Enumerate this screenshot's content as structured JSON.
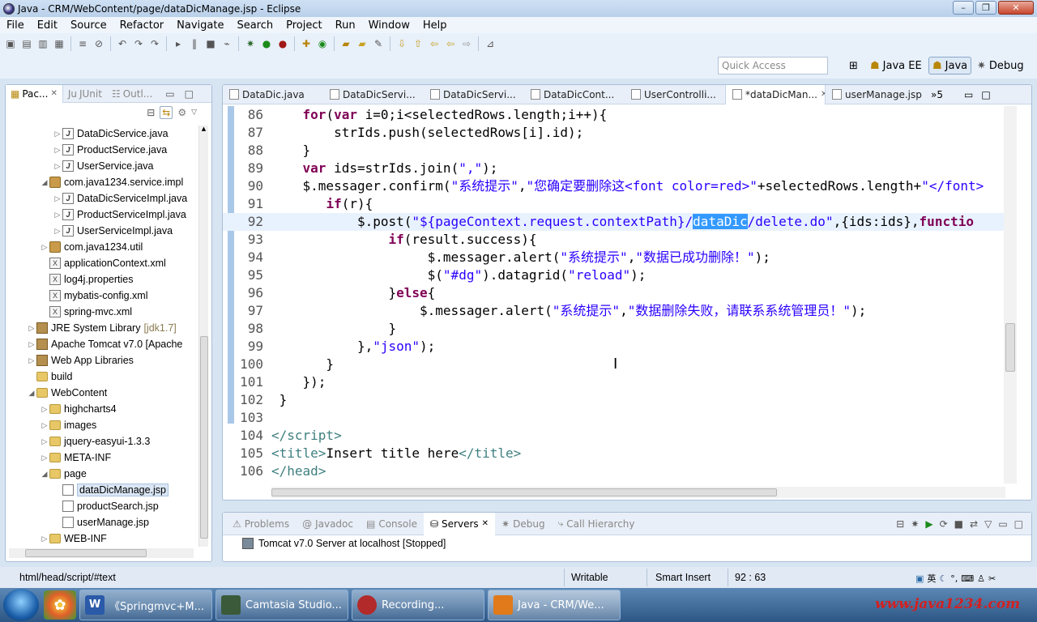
{
  "window": {
    "title": "Java - CRM/WebContent/page/dataDicManage.jsp - Eclipse"
  },
  "menu": [
    "File",
    "Edit",
    "Source",
    "Refactor",
    "Navigate",
    "Search",
    "Project",
    "Run",
    "Window",
    "Help"
  ],
  "quick_access": {
    "placeholder": "Quick Access"
  },
  "perspectives": [
    "Java EE",
    "Java",
    "Debug"
  ],
  "left_panel": {
    "tabs": [
      "Pac...",
      "JUnit",
      "Outl..."
    ],
    "tree": [
      {
        "label": "DataDicService.java",
        "type": "java",
        "indent": 4,
        "arrow": "▷"
      },
      {
        "label": "ProductService.java",
        "type": "java",
        "indent": 4,
        "arrow": "▷"
      },
      {
        "label": "UserService.java",
        "type": "java",
        "indent": 4,
        "arrow": "▷"
      },
      {
        "label": "com.java1234.service.impl",
        "type": "pack",
        "indent": 3,
        "arrow": "◢"
      },
      {
        "label": "DataDicServiceImpl.java",
        "type": "java",
        "indent": 4,
        "arrow": "▷"
      },
      {
        "label": "ProductServiceImpl.java",
        "type": "java",
        "indent": 4,
        "arrow": "▷"
      },
      {
        "label": "UserServiceImpl.java",
        "type": "java",
        "indent": 4,
        "arrow": "▷"
      },
      {
        "label": "com.java1234.util",
        "type": "pack",
        "indent": 3,
        "arrow": "▷"
      },
      {
        "label": "applicationContext.xml",
        "type": "xml",
        "indent": 3,
        "arrow": ""
      },
      {
        "label": "log4j.properties",
        "type": "xml",
        "indent": 3,
        "arrow": ""
      },
      {
        "label": "mybatis-config.xml",
        "type": "xml",
        "indent": 3,
        "arrow": ""
      },
      {
        "label": "spring-mvc.xml",
        "type": "xml",
        "indent": 3,
        "arrow": ""
      },
      {
        "label": "JRE System Library",
        "suffix": "[jdk1.7]",
        "type": "lib",
        "indent": 2,
        "arrow": "▷"
      },
      {
        "label": "Apache Tomcat v7.0 [Apache",
        "type": "lib",
        "indent": 2,
        "arrow": "▷"
      },
      {
        "label": "Web App Libraries",
        "type": "lib",
        "indent": 2,
        "arrow": "▷"
      },
      {
        "label": "build",
        "type": "folder",
        "indent": 2,
        "arrow": ""
      },
      {
        "label": "WebContent",
        "type": "folder",
        "indent": 2,
        "arrow": "◢"
      },
      {
        "label": "highcharts4",
        "type": "folder",
        "indent": 3,
        "arrow": "▷"
      },
      {
        "label": "images",
        "type": "folder",
        "indent": 3,
        "arrow": "▷"
      },
      {
        "label": "jquery-easyui-1.3.3",
        "type": "folder",
        "indent": 3,
        "arrow": "▷"
      },
      {
        "label": "META-INF",
        "type": "folder",
        "indent": 3,
        "arrow": "▷"
      },
      {
        "label": "page",
        "type": "folder",
        "indent": 3,
        "arrow": "◢"
      },
      {
        "label": "dataDicManage.jsp",
        "type": "jsp",
        "indent": 4,
        "arrow": "",
        "selected": true
      },
      {
        "label": "productSearch.jsp",
        "type": "jsp",
        "indent": 4,
        "arrow": ""
      },
      {
        "label": "userManage.jsp",
        "type": "jsp",
        "indent": 4,
        "arrow": ""
      },
      {
        "label": "WEB-INF",
        "type": "folder",
        "indent": 3,
        "arrow": "▷"
      }
    ]
  },
  "editor_tabs": [
    "DataDic.java",
    "DataDicServi...",
    "DataDicServi...",
    "DataDicCont...",
    "UserControlli...",
    "*dataDicMan...",
    "userManage.jsp"
  ],
  "editor_overflow": "»5",
  "code": [
    {
      "n": "86",
      "html": "    <span class='kw'>for</span>(<span class='kw'>var</span> i=0;i&lt;selectedRows.length;i++){"
    },
    {
      "n": "87",
      "html": "        strIds.push(selectedRows[i].id);"
    },
    {
      "n": "88",
      "html": "    }"
    },
    {
      "n": "89",
      "html": "    <span class='kw'>var</span> ids=strIds.join(<span class='str'>\",\"</span>);"
    },
    {
      "n": "90",
      "html": "    $.messager.confirm(<span class='str'>\"系统提示\"</span>,<span class='str'>\"您确定要删除这&lt;font color=red&gt;\"</span>+selectedRows.length+<span class='str'>\"&lt;/font&gt;</span>"
    },
    {
      "n": "91",
      "html": "       <span class='kw'>if</span>(r){"
    },
    {
      "n": "92",
      "html": "           $.post(<span class='str'>\"${pageContext.request.contextPath}/<span class='hl'>dataDic</span>/delete.do\"</span>,{ids:ids},<span class='kw'>functio</span>",
      "cur": true
    },
    {
      "n": "93",
      "html": "               <span class='kw'>if</span>(result.success){"
    },
    {
      "n": "94",
      "html": "                    $.messager.alert(<span class='str'>\"系统提示\"</span>,<span class='str'>\"数据已成功删除！\"</span>);"
    },
    {
      "n": "95",
      "html": "                    $(<span class='str'>\"#dg\"</span>).datagrid(<span class='str'>\"reload\"</span>);"
    },
    {
      "n": "96",
      "html": "               }<span class='kw'>else</span>{"
    },
    {
      "n": "97",
      "html": "                   $.messager.alert(<span class='str'>\"系统提示\"</span>,<span class='str'>\"数据删除失败，请联系系统管理员！\"</span>);"
    },
    {
      "n": "98",
      "html": "               }"
    },
    {
      "n": "99",
      "html": "           },<span class='str'>\"json\"</span>);"
    },
    {
      "n": "100",
      "html": "       }"
    },
    {
      "n": "101",
      "html": "    });"
    },
    {
      "n": "102",
      "html": " }"
    },
    {
      "n": "103",
      "html": ""
    },
    {
      "n": "104",
      "html": "<span class='tag'>&lt;/script&gt;</span>"
    },
    {
      "n": "105",
      "html": "<span class='tag'>&lt;title&gt;</span>Insert title here<span class='tag'>&lt;/title&gt;</span>"
    },
    {
      "n": "106",
      "html": "<span class='tag'>&lt;/head&gt;</span>"
    }
  ],
  "console_tabs": [
    "Problems",
    "Javadoc",
    "Console",
    "Servers",
    "Debug",
    "Call Hierarchy"
  ],
  "console_server": "Tomcat v7.0 Server at localhost  [Stopped]",
  "status": {
    "path": "html/head/script/#text",
    "writable": "Writable",
    "insert": "Smart Insert",
    "position": "92 : 63"
  },
  "taskbar": [
    {
      "label": "《Springmvc+M..."
    },
    {
      "label": "Camtasia Studio..."
    },
    {
      "label": "Recording..."
    },
    {
      "label": "Java - CRM/We..."
    }
  ],
  "tray": {
    "ime": "英"
  },
  "watermark": "www.java1234.com"
}
